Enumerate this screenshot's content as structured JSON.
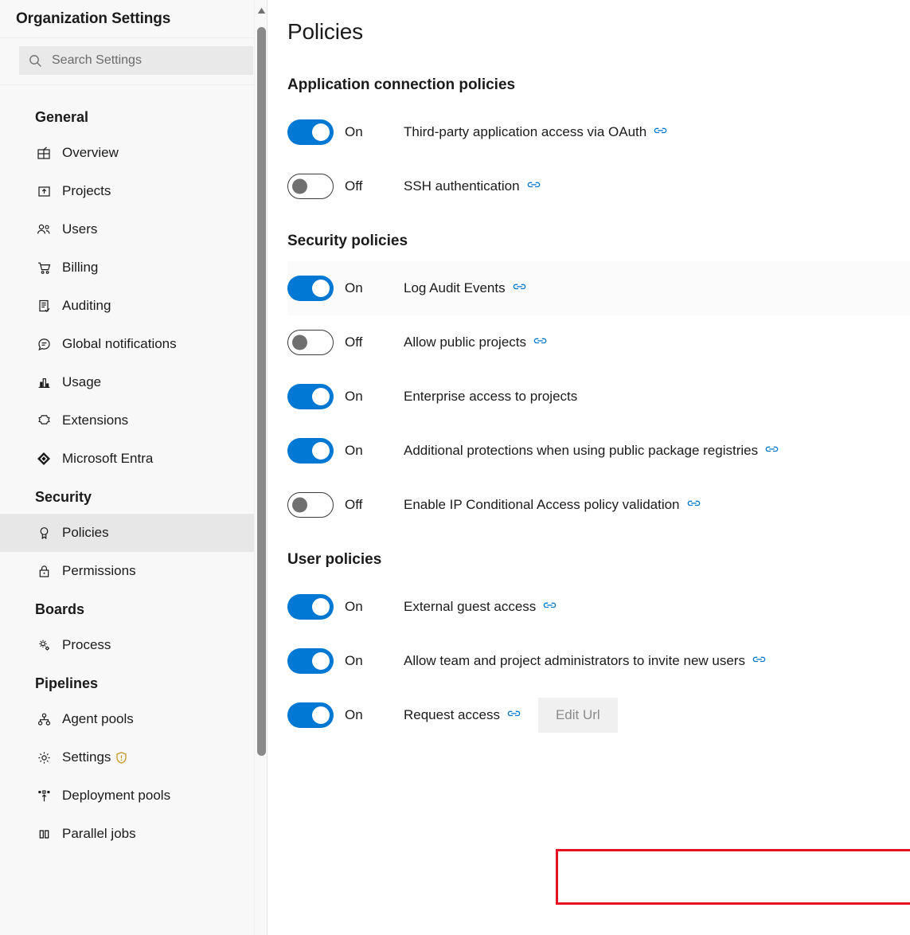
{
  "sidebar": {
    "title": "Organization Settings",
    "search": {
      "placeholder": "Search Settings",
      "value": "",
      "icon": "search-icon"
    },
    "groups": [
      {
        "title": "General",
        "items": [
          {
            "label": "Overview",
            "icon": "overview-icon",
            "selected": false
          },
          {
            "label": "Projects",
            "icon": "projects-icon",
            "selected": false
          },
          {
            "label": "Users",
            "icon": "users-icon",
            "selected": false
          },
          {
            "label": "Billing",
            "icon": "billing-cart-icon",
            "selected": false
          },
          {
            "label": "Auditing",
            "icon": "auditing-icon",
            "selected": false
          },
          {
            "label": "Global notifications",
            "icon": "notifications-icon",
            "selected": false
          },
          {
            "label": "Usage",
            "icon": "usage-chart-icon",
            "selected": false
          },
          {
            "label": "Extensions",
            "icon": "extensions-icon",
            "selected": false
          },
          {
            "label": "Microsoft Entra",
            "icon": "microsoft-entra-icon",
            "selected": false
          }
        ]
      },
      {
        "title": "Security",
        "items": [
          {
            "label": "Policies",
            "icon": "policies-ribbon-icon",
            "selected": true
          },
          {
            "label": "Permissions",
            "icon": "lock-icon",
            "selected": false
          }
        ]
      },
      {
        "title": "Boards",
        "items": [
          {
            "label": "Process",
            "icon": "process-gear-icon",
            "selected": false
          }
        ]
      },
      {
        "title": "Pipelines",
        "items": [
          {
            "label": "Agent pools",
            "icon": "agent-pools-icon",
            "selected": false
          },
          {
            "label": "Settings",
            "icon": "gear-icon",
            "selected": false,
            "warning": true
          },
          {
            "label": "Deployment pools",
            "icon": "deployment-pools-icon",
            "selected": false
          },
          {
            "label": "Parallel jobs",
            "icon": "parallel-jobs-icon",
            "selected": false
          }
        ]
      }
    ],
    "scrollbar": {
      "up_arrow": "scroll-up-arrow"
    }
  },
  "main": {
    "page_title": "Policies",
    "sections": [
      {
        "title": "Application connection policies",
        "rows": [
          {
            "state": "On",
            "on": true,
            "label": "Third-party application access via OAuth",
            "link": true
          },
          {
            "state": "Off",
            "on": false,
            "label": "SSH authentication",
            "link": true
          }
        ]
      },
      {
        "title": "Security policies",
        "rows": [
          {
            "state": "On",
            "on": true,
            "label": "Log Audit Events",
            "link": true,
            "shaded": true
          },
          {
            "state": "Off",
            "on": false,
            "label": "Allow public projects",
            "link": true
          },
          {
            "state": "On",
            "on": true,
            "label": "Enterprise access to projects",
            "link": false
          },
          {
            "state": "On",
            "on": true,
            "label": "Additional protections when using public package registries",
            "link": true
          },
          {
            "state": "Off",
            "on": false,
            "label": "Enable IP Conditional Access policy validation",
            "link": true
          }
        ]
      },
      {
        "title": "User policies",
        "rows": [
          {
            "state": "On",
            "on": true,
            "label": "External guest access",
            "link": true
          },
          {
            "state": "On",
            "on": true,
            "label": "Allow team and project administrators to invite new users",
            "link": true
          },
          {
            "state": "On",
            "on": true,
            "label": "Request access",
            "link": true,
            "button": "Edit Url",
            "highlighted": true
          }
        ]
      }
    ]
  },
  "colors": {
    "toggle_on": "#0078d4",
    "toggle_off_knob": "#707070",
    "link_icon": "#0078d4",
    "highlight_box": "#e81123",
    "sidebar_bg": "#f8f8f8",
    "selected_item_bg": "#e7e7e7",
    "warning_shield": "#c4911c",
    "button_bg": "#f0f0f0",
    "button_text": "#8a8a8a"
  }
}
